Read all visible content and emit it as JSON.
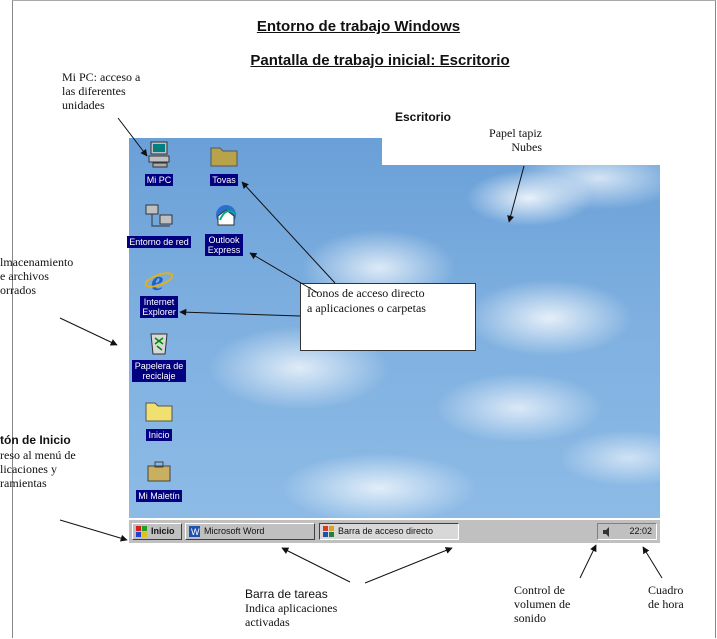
{
  "titles": {
    "main": "Entorno de trabajo Windows",
    "sub": "Pantalla de trabajo inicial: Escritorio"
  },
  "notes": {
    "mipc": "Mi PC: acceso a\nlas diferentes\nunidades",
    "escritorio": "Escritorio",
    "papel": "Papel tapiz\nNubes",
    "almacen": "lmacenamiento\ne archivos\norrados",
    "inicio_title": "tón de Inicio",
    "inicio_body": "reso al menú  de\nlicaciones y\nramientas",
    "iconos": "Íconos de acceso directo\na aplicaciones o carpetas",
    "barra_title": "Barra de tareas",
    "barra_body": "Indica aplicaciones\nactivadas",
    "volumen": "Control de\nvolumen de\nsonido",
    "hora": "Cuadro\nde hora"
  },
  "desktop_icons": [
    {
      "name": "mi-pc",
      "label": "Mi PC",
      "icon": "computer-icon"
    },
    {
      "name": "tovas",
      "label": "Tovas",
      "icon": "folder-icon"
    },
    {
      "name": "entorno-red",
      "label": "Entorno de red",
      "icon": "network-icon"
    },
    {
      "name": "outlook",
      "label": "Outlook Express",
      "icon": "outlook-icon"
    },
    {
      "name": "ie",
      "label": "Internet Explorer",
      "icon": "ie-icon"
    },
    {
      "name": "papelera",
      "label": "Papelera de reciclaje",
      "icon": "recycle-bin-icon"
    },
    {
      "name": "inicio-folder",
      "label": "Inicio",
      "icon": "folder-icon"
    },
    {
      "name": "maletin",
      "label": "Mi Maletín",
      "icon": "briefcase-icon"
    }
  ],
  "taskbar": {
    "start": "Inicio",
    "word": "Microsoft Word",
    "barra_acceso": "Barra de acceso directo",
    "clock": "22:02"
  },
  "colors": {
    "sky": "#7fb0e0",
    "taskbar": "#c0c0c0",
    "label_bg": "#000080"
  }
}
